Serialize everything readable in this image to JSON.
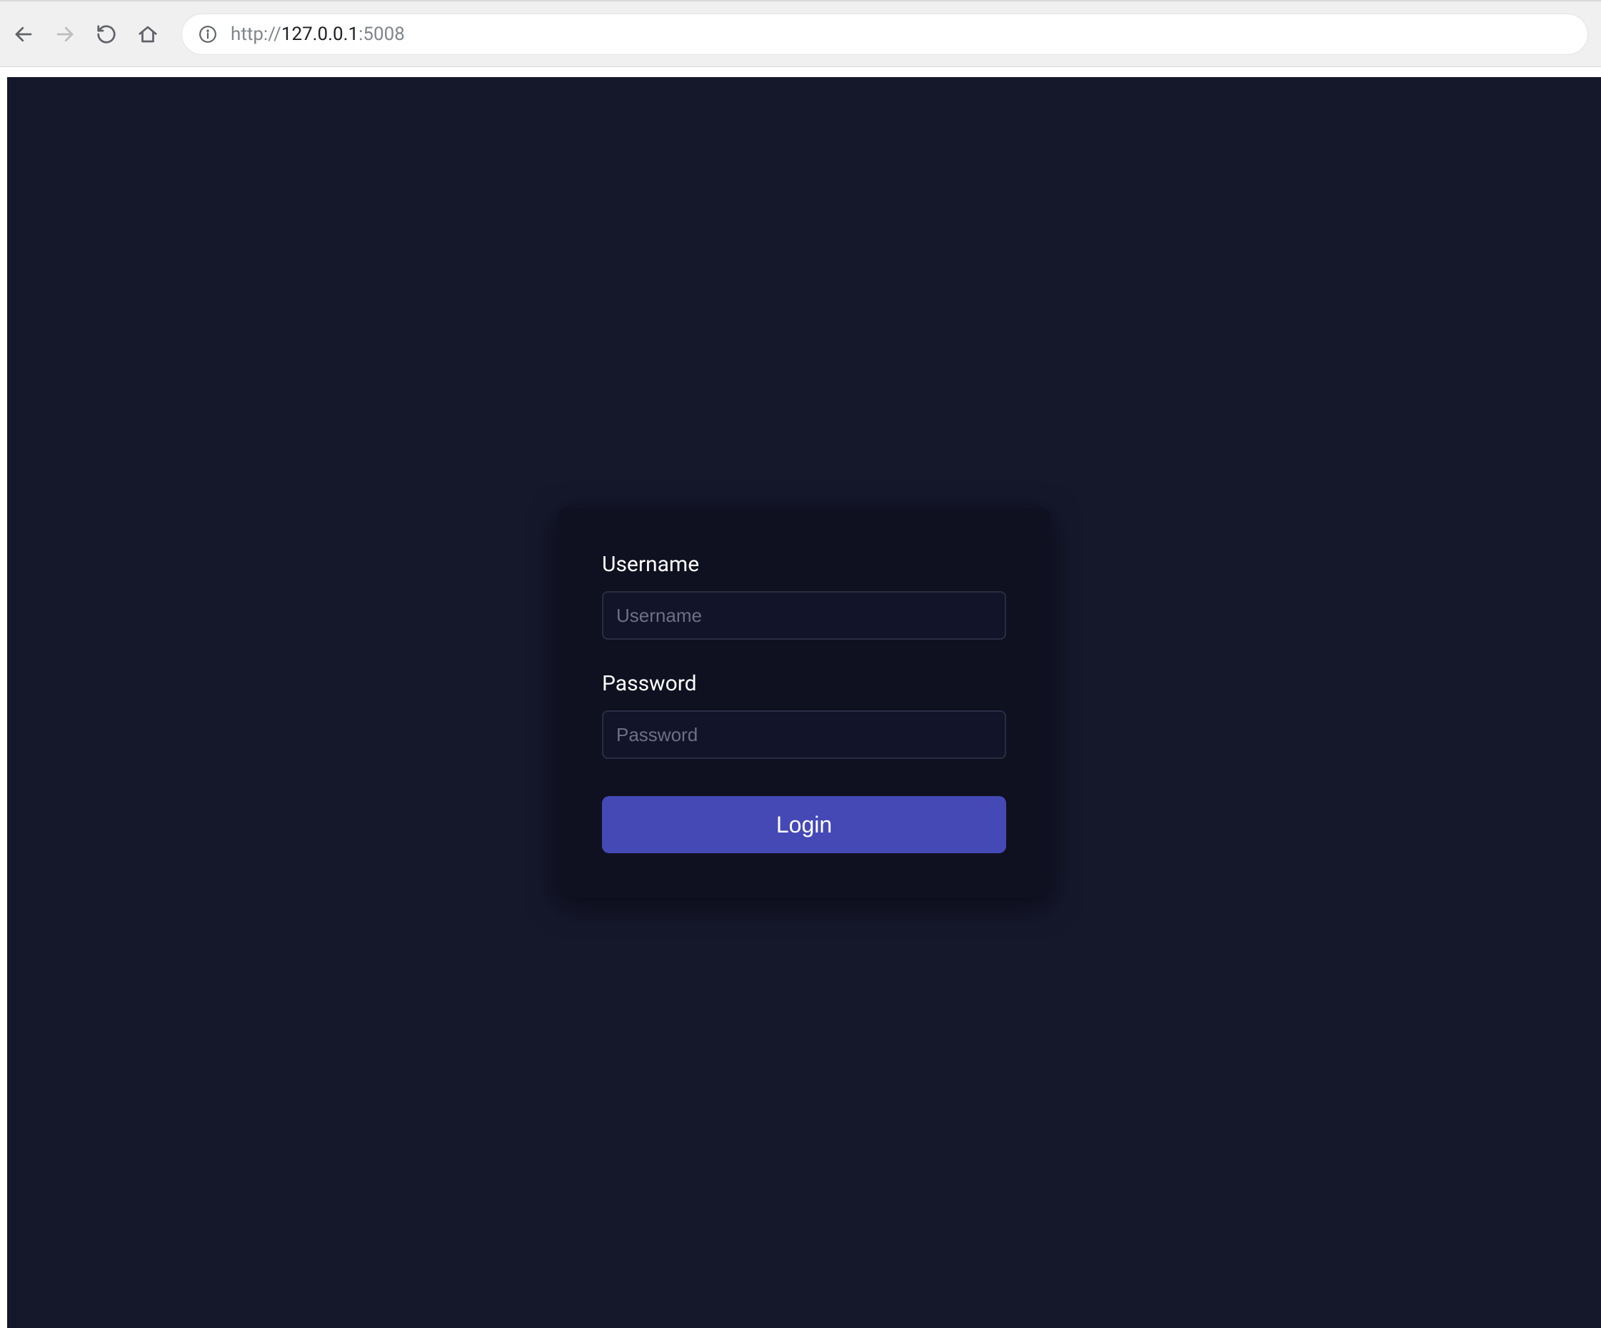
{
  "browser": {
    "url_prefix": "http://",
    "url_host": "127.0.0.1",
    "url_port": ":5008"
  },
  "form": {
    "username_label": "Username",
    "username_placeholder": "Username",
    "username_value": "",
    "password_label": "Password",
    "password_placeholder": "Password",
    "password_value": "",
    "login_button_label": "Login"
  }
}
